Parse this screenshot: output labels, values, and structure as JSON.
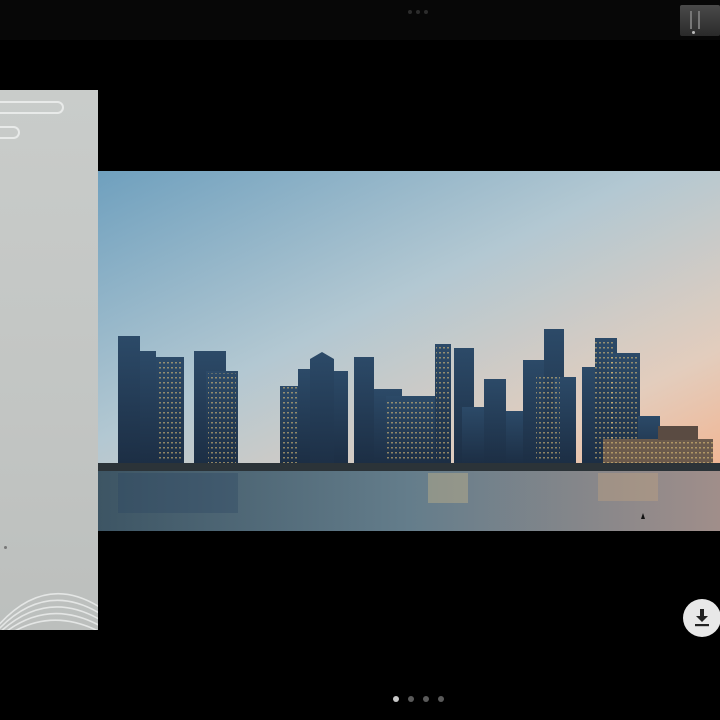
{
  "viewer": {
    "current_page": 1,
    "page_count": 4,
    "image_subject": "city-skyline-at-dusk"
  },
  "icons": {
    "download": "download-icon"
  },
  "colors": {
    "background": "#000000",
    "panel": "#c4c7c5",
    "button": "#e8e8e8",
    "pager_active": "#c8c8c8",
    "pager_inactive": "#5a5a5a"
  }
}
